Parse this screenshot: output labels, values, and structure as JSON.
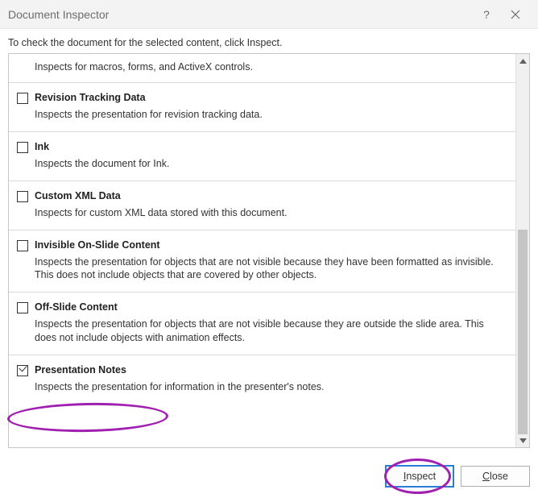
{
  "titlebar": {
    "title": "Document Inspector",
    "help": "?",
    "close": "×"
  },
  "prompt": "To check the document for the selected content, click Inspect.",
  "items": {
    "partial_desc": "Inspects for macros, forms, and ActiveX controls.",
    "i1_label": "Revision Tracking Data",
    "i1_desc": "Inspects the presentation for revision tracking data.",
    "i2_label": "Ink",
    "i2_desc": "Inspects the document for Ink.",
    "i3_label": "Custom XML Data",
    "i3_desc": "Inspects for custom XML data stored with this document.",
    "i4_label": "Invisible On-Slide Content",
    "i4_desc": "Inspects the presentation for objects that are not visible because they have been formatted as invisible. This does not include objects that are covered by other objects.",
    "i5_label": "Off-Slide Content",
    "i5_desc": "Inspects the presentation for objects that are not visible because they are outside the slide area. This does not include objects with animation effects.",
    "i6_label": "Presentation Notes",
    "i6_desc": "Inspects the presentation for information in the presenter's notes."
  },
  "buttons": {
    "inspect_pre": "",
    "inspect_accel": "I",
    "inspect_post": "nspect",
    "close_pre": "",
    "close_accel": "C",
    "close_post": "lose"
  },
  "checked": {
    "i1": false,
    "i2": false,
    "i3": false,
    "i4": false,
    "i5": false,
    "i6": true
  }
}
